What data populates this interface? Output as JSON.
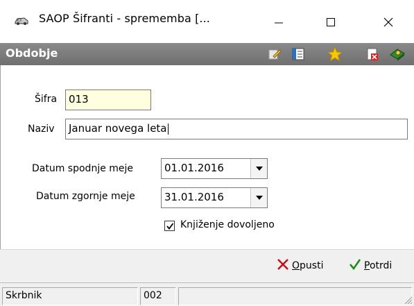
{
  "window": {
    "title": "SAOP Šifranti - sprememba [...",
    "icon": "car-icon",
    "controls": {
      "minimize": "—",
      "maximize": "☐",
      "close": "✕"
    }
  },
  "header": {
    "title": "Obdobje",
    "icons": [
      "edit-icon",
      "properties-icon",
      "favorite-star-icon",
      "delete-document-icon",
      "help-book-icon"
    ]
  },
  "form": {
    "sifra": {
      "label": "Šifra",
      "value": "013"
    },
    "naziv": {
      "label": "Naziv",
      "value": "Januar novega leta"
    },
    "datum_spodnje": {
      "label": "Datum spodnje meje",
      "value": "01.01.2016"
    },
    "datum_zgornje": {
      "label": "Datum zgornje meje",
      "value": "31.01.2016"
    },
    "knjizenje": {
      "label": "Knjiženje dovoljeno",
      "checked": true
    }
  },
  "actions": {
    "cancel": {
      "accel": "O",
      "rest": "pusti"
    },
    "confirm": {
      "accel": "P",
      "rest": "otrdi"
    }
  },
  "status": {
    "panel1": "Skrbnik",
    "panel2": "002",
    "panel3": ""
  },
  "colors": {
    "header_bg": "#7d7d7d",
    "code_field_bg": "#ffffe0",
    "cancel_red": "#c0141c",
    "confirm_green": "#1f8a1f"
  }
}
